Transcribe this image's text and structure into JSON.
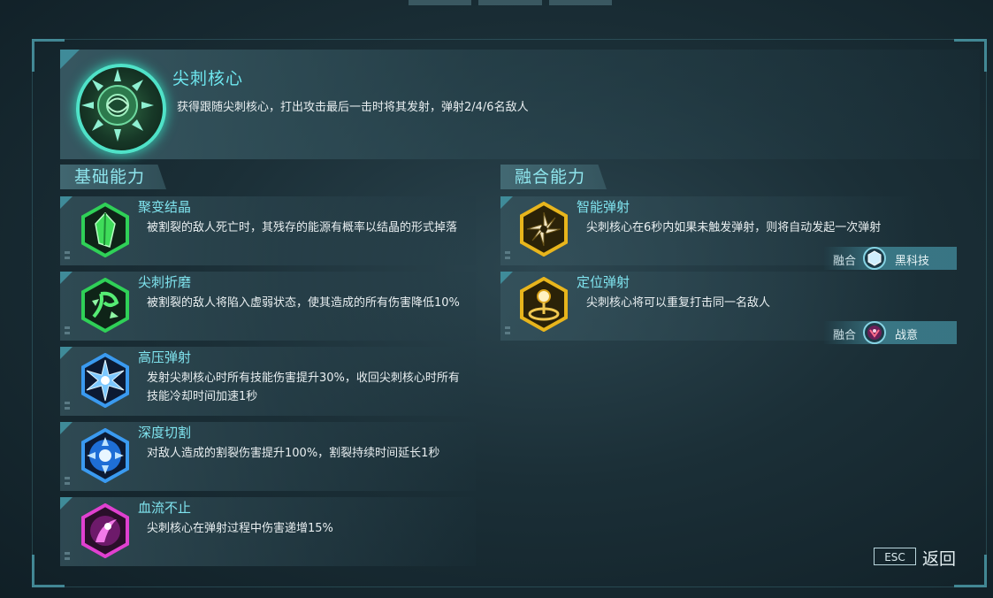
{
  "core": {
    "title": "尖刺核心",
    "description": "获得跟随尖刺核心，打出攻击最后一击时将其发射，弹射2/4/6名敌人"
  },
  "sections": {
    "basic": "基础能力",
    "fusion": "融合能力"
  },
  "basic_skills": [
    {
      "name": "聚变结晶",
      "desc": "被割裂的敌人死亡时，其残存的能源有概率以结晶的形式掉落",
      "icon": "green-crystal-icon",
      "color": "#27c24a"
    },
    {
      "name": "尖刺折磨",
      "desc": "被割裂的敌人将陷入虚弱状态，使其造成的所有伤害降低10%",
      "icon": "thorn-vine-icon",
      "color": "#27c24a"
    },
    {
      "name": "高压弹射",
      "desc": "发射尖刺核心时所有技能伤害提升30%，收回尖刺核心时所有技能冷却时间加速1秒",
      "icon": "blue-burst-icon",
      "color": "#2e8fe6"
    },
    {
      "name": "深度切割",
      "desc": "对敌人造成的割裂伤害提升100%，割裂持续时间延长1秒",
      "icon": "blue-saw-icon",
      "color": "#2e8fe6"
    },
    {
      "name": "血流不止",
      "desc": "尖刺核心在弹射过程中伤害递增15%",
      "icon": "magenta-wound-icon",
      "color": "#d43bc8"
    }
  ],
  "fusion_skills": [
    {
      "name": "智能弹射",
      "desc": "尖刺核心在6秒内如果未触发弹射，则将自动发起一次弹射",
      "icon": "gold-shuriken-icon",
      "color": "#e2b017",
      "tag": {
        "label": "融合",
        "name": "黑科技",
        "icon": "black-tech-icon"
      }
    },
    {
      "name": "定位弹射",
      "desc": "尖刺核心将可以重复打击同一名敌人",
      "icon": "gold-target-icon",
      "color": "#e2b017",
      "tag": {
        "label": "融合",
        "name": "战意",
        "icon": "battle-will-icon"
      }
    }
  ],
  "footer": {
    "esc": "ESC",
    "back": "返回"
  }
}
